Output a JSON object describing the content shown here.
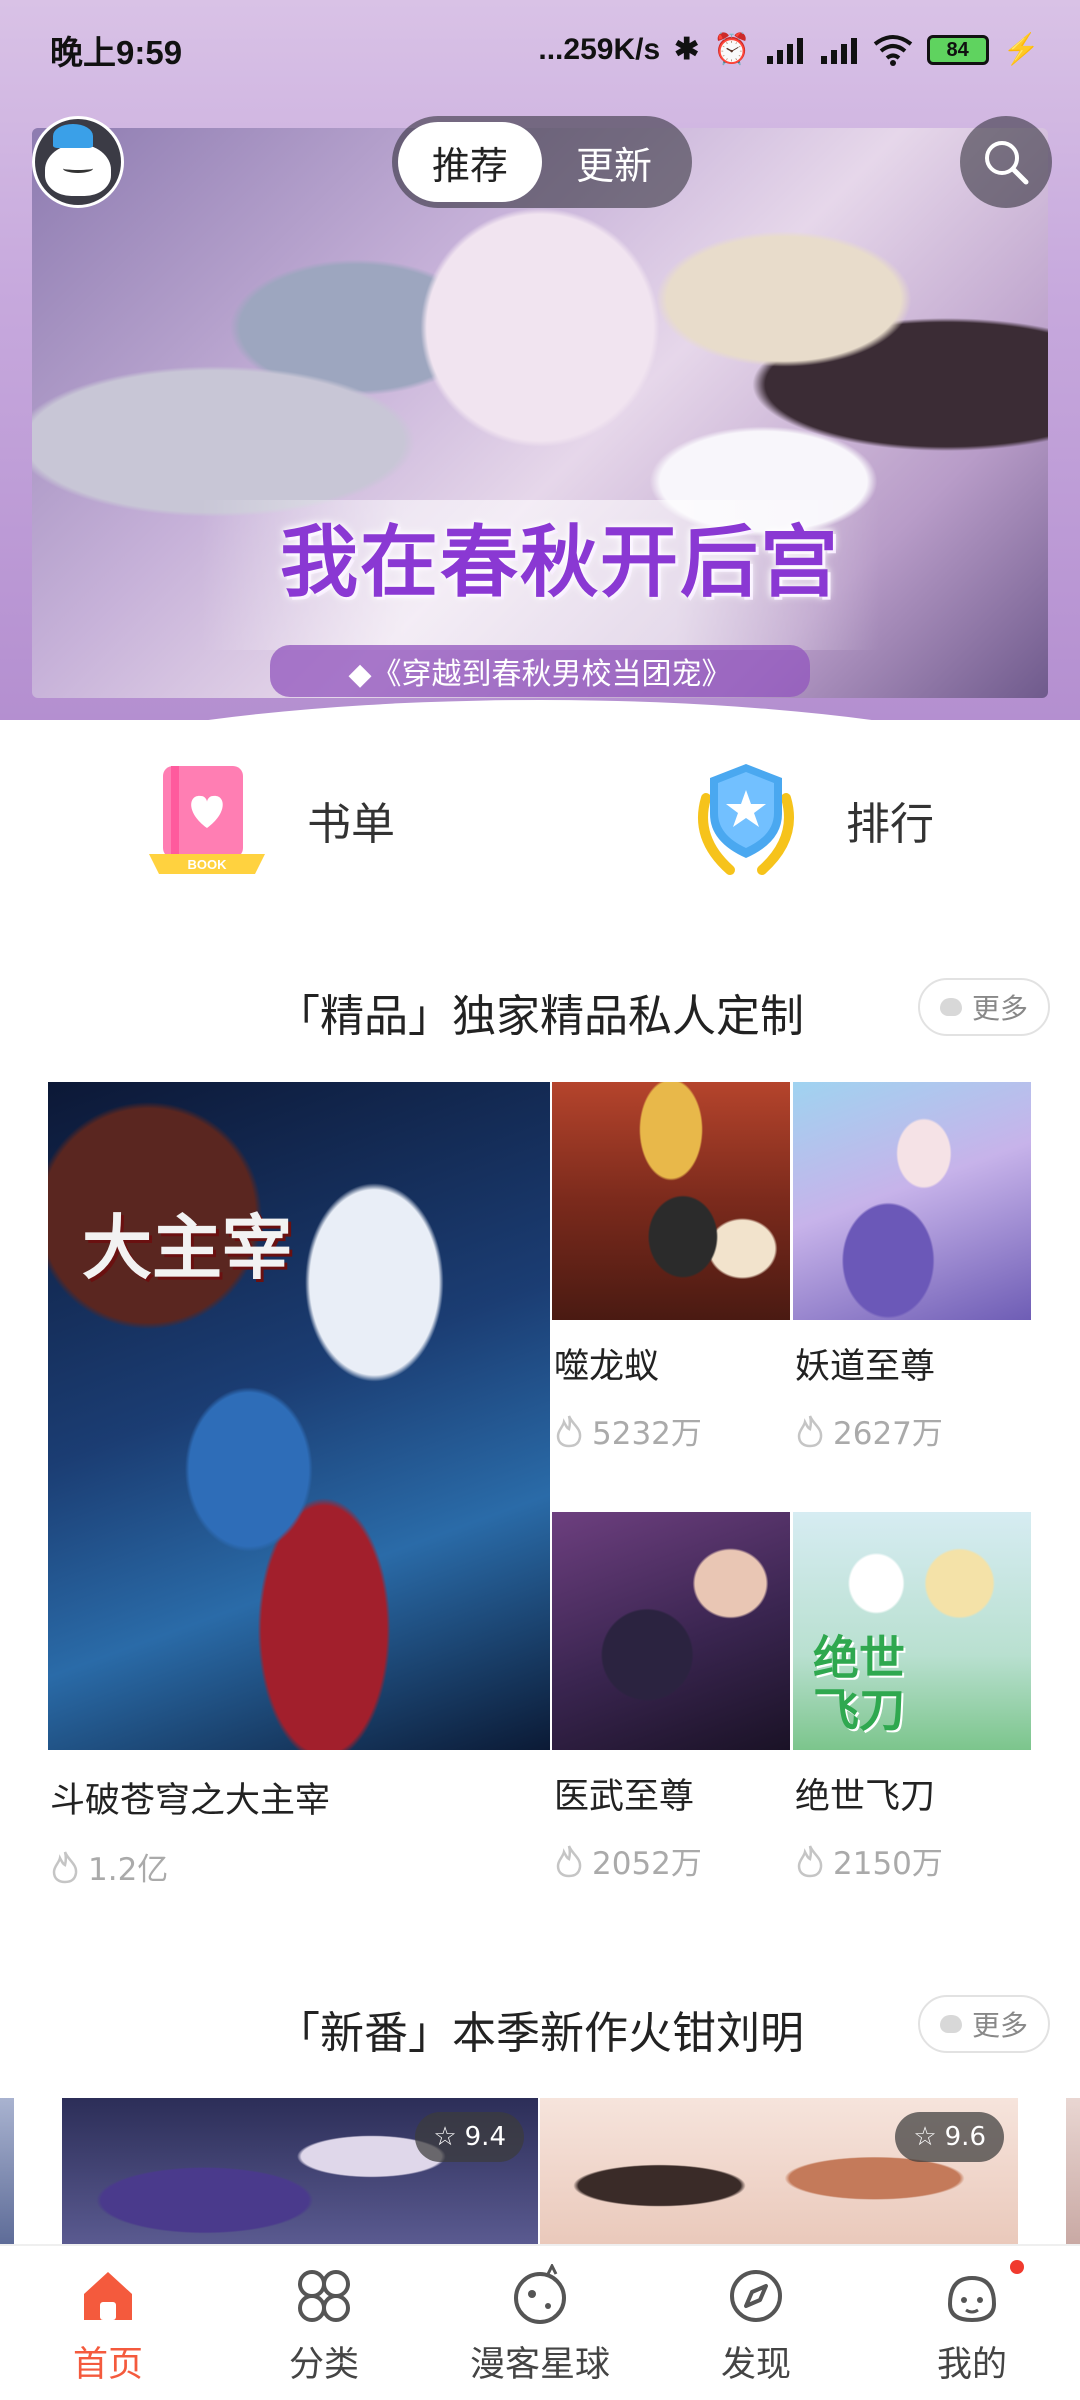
{
  "status_bar": {
    "time": "晚上9:59",
    "network_speed": "...259K/s",
    "battery": "84",
    "icons": [
      "bluetooth-icon",
      "alarm-icon",
      "signal-hd-icon",
      "signal-hd-icon",
      "wifi-icon",
      "battery-icon",
      "charging-icon"
    ]
  },
  "header": {
    "tabs": [
      {
        "label": "推荐",
        "active": true
      },
      {
        "label": "更新",
        "active": false
      }
    ],
    "search_icon": "search-icon",
    "avatar_icon": "mascot-avatar"
  },
  "banner": {
    "title": "我在春秋开后宫",
    "subtitle": "◆《穿越到春秋男校当团宠》"
  },
  "quick_entries": [
    {
      "label": "书单",
      "icon": "book-list-icon",
      "icon_text": "BOOK"
    },
    {
      "label": "排行",
      "icon": "ranking-shield-icon"
    }
  ],
  "sections": [
    {
      "title": "「精品」独家精品私人定制",
      "more": "更多",
      "items": [
        {
          "name": "斗破苍穹之大主宰",
          "heat": "1.2亿",
          "cover_text": "大主宰"
        },
        {
          "name": "噬龙蚁",
          "heat": "5232万"
        },
        {
          "name": "妖道至尊",
          "heat": "2627万"
        },
        {
          "name": "医武至尊",
          "heat": "2052万"
        },
        {
          "name": "绝世飞刀",
          "heat": "2150万",
          "cover_text": "绝世飞刀"
        }
      ]
    },
    {
      "title": "「新番」本季新作火钳刘明",
      "more": "更多",
      "items": [
        {
          "rating": "9.4"
        },
        {
          "rating": "9.6"
        }
      ]
    }
  ],
  "bottom_nav": [
    {
      "label": "首页",
      "icon": "home-icon",
      "active": true
    },
    {
      "label": "分类",
      "icon": "category-icon",
      "active": false
    },
    {
      "label": "漫客星球",
      "icon": "planet-icon",
      "active": false
    },
    {
      "label": "发现",
      "icon": "compass-icon",
      "active": false
    },
    {
      "label": "我的",
      "icon": "mascot-icon",
      "active": false,
      "badge": true
    }
  ],
  "colors": {
    "accent": "#f45a3d",
    "banner_title": "#8a38d3",
    "muted_text": "#aaaaaa"
  }
}
